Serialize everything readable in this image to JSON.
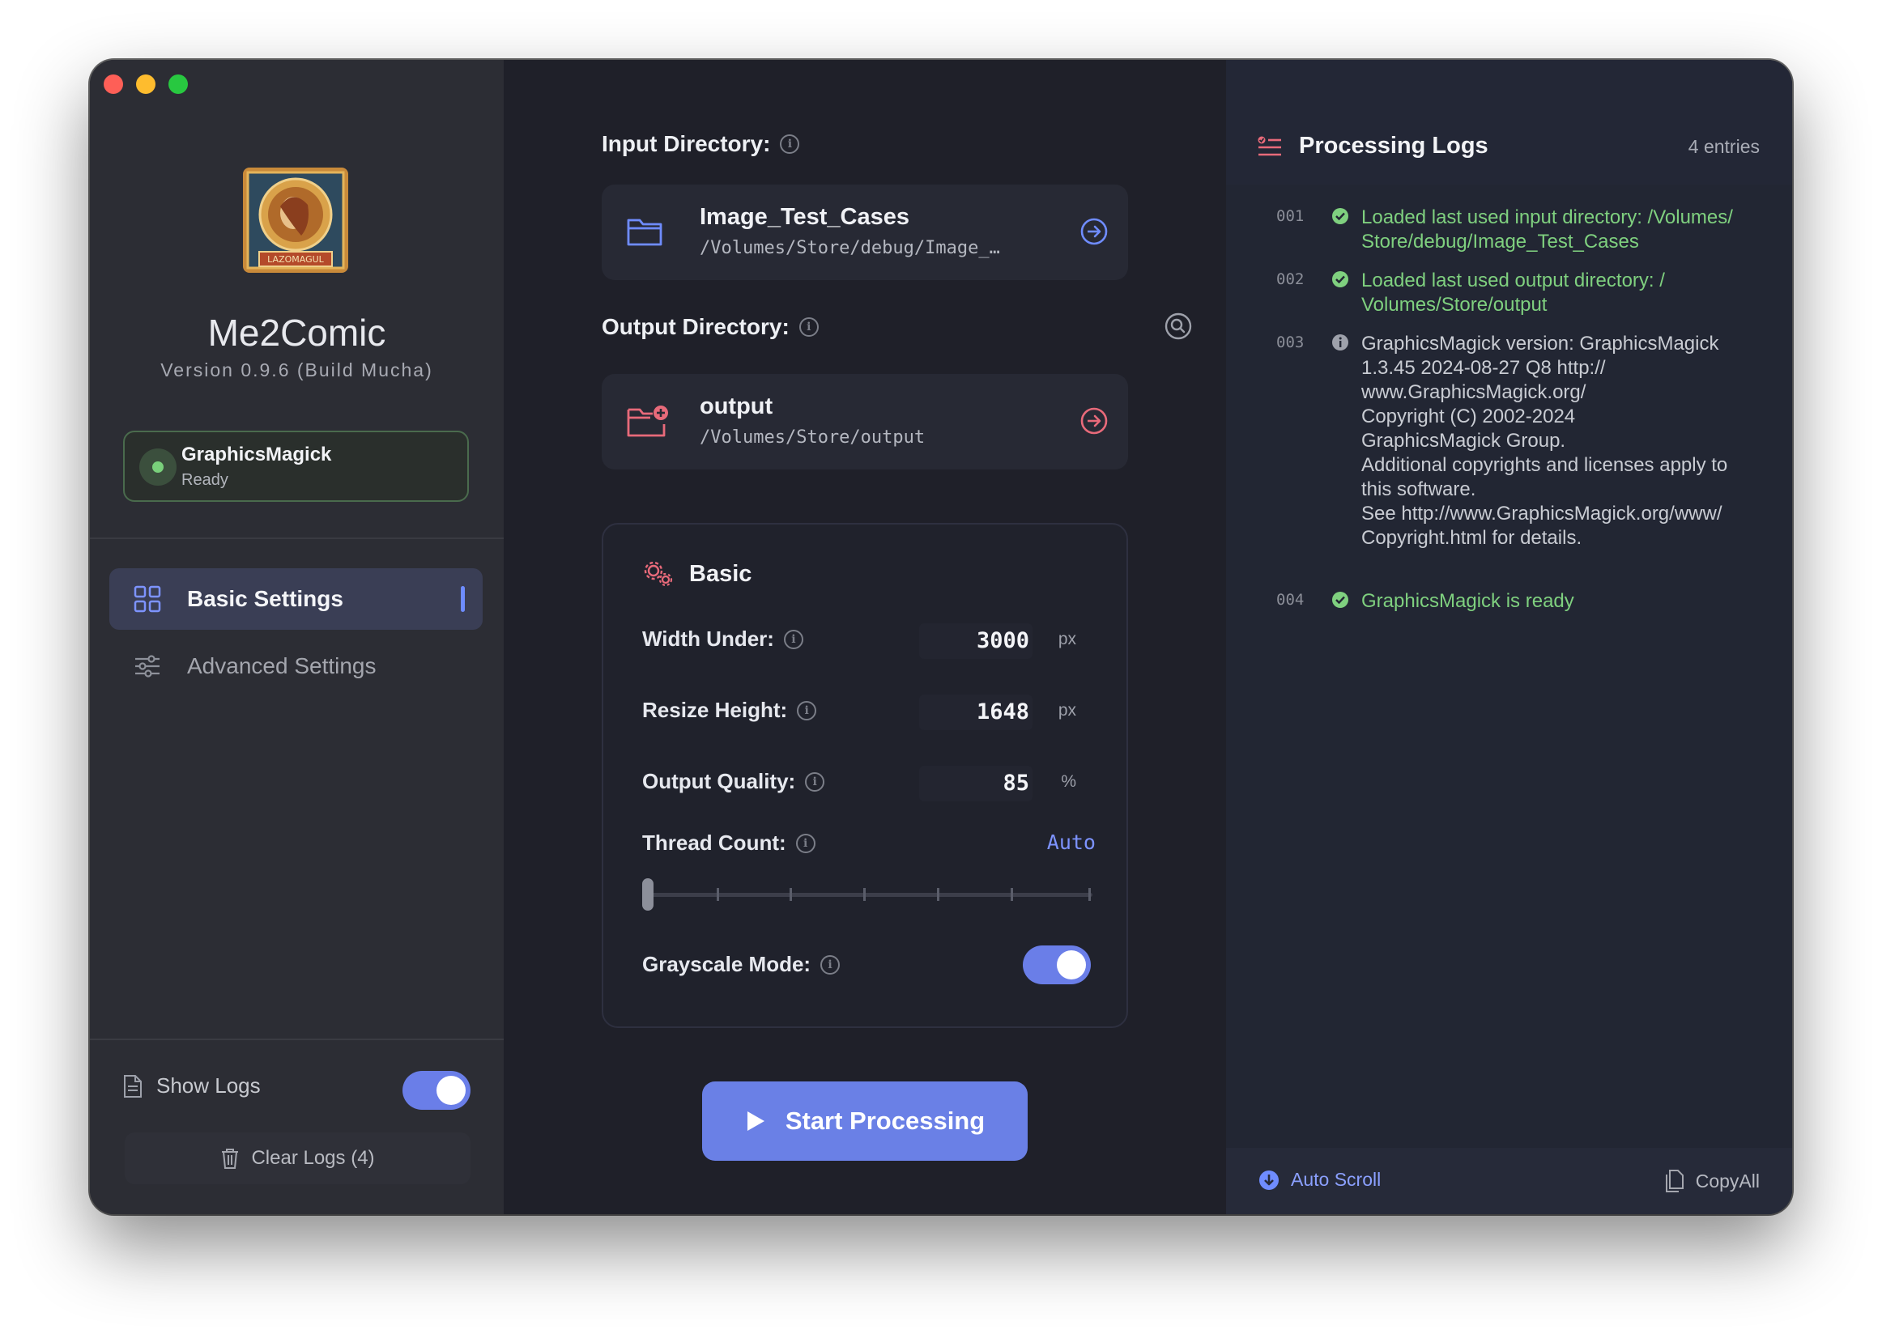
{
  "app": {
    "name": "Me2Comic",
    "version": "Version 0.9.6 (Build Mucha)",
    "logo_text": "LAZOMAGUL"
  },
  "engine": {
    "name": "GraphicsMagick",
    "status": "Ready"
  },
  "sidebar": {
    "items": [
      {
        "label": "Basic Settings",
        "icon": "grid-icon",
        "active": true
      },
      {
        "label": "Advanced Settings",
        "icon": "sliders-icon",
        "active": false
      }
    ],
    "show_logs_label": "Show Logs",
    "show_logs_on": true,
    "clear_logs_label": "Clear Logs (4)"
  },
  "input": {
    "label": "Input Directory:",
    "name": "Image_Test_Cases",
    "path": "/Volumes/Store/debug/Image_…"
  },
  "output": {
    "label": "Output Directory:",
    "name": "output",
    "path": "/Volumes/Store/output"
  },
  "basic": {
    "title": "Basic",
    "width_label": "Width Under:",
    "width_value": "3000",
    "width_unit": "px",
    "height_label": "Resize Height:",
    "height_value": "1648",
    "height_unit": "px",
    "quality_label": "Output Quality:",
    "quality_value": "85",
    "quality_unit": "%",
    "threads_label": "Thread Count:",
    "threads_value": "Auto",
    "threads_slider_fraction": 0,
    "grayscale_label": "Grayscale Mode:",
    "grayscale_on": true
  },
  "start_label": "Start Processing",
  "logs": {
    "title": "Processing Logs",
    "count": "4 entries",
    "entries": [
      {
        "num": "001",
        "type": "success",
        "msg": "Loaded last used input directory: /Volumes/\nStore/debug/Image_Test_Cases"
      },
      {
        "num": "002",
        "type": "success",
        "msg": "Loaded last used output directory: /\nVolumes/Store/output"
      },
      {
        "num": "003",
        "type": "info",
        "msg": "GraphicsMagick version: GraphicsMagick\n1.3.45 2024-08-27 Q8 http://\nwww.GraphicsMagick.org/\nCopyright (C) 2002-2024\nGraphicsMagick Group.\nAdditional copyrights and licenses apply to\nthis software.\nSee http://www.GraphicsMagick.org/www/\nCopyright.html for details."
      },
      {
        "num": "004",
        "type": "success",
        "msg": "GraphicsMagick is ready"
      }
    ],
    "auto_scroll_label": "Auto Scroll",
    "copy_all_label": "CopyAll"
  },
  "colors": {
    "accent": "#6a80e6",
    "success": "#7fd07f",
    "output_folder": "#e86a7a"
  }
}
